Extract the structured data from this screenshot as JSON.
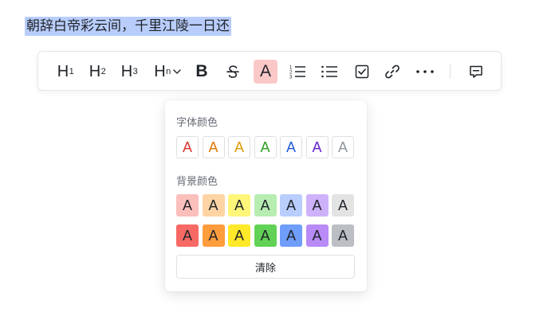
{
  "document": {
    "selected_text": "朝辞白帝彩云间，千里江陵一日还"
  },
  "toolbar": {
    "h1": {
      "main": "H",
      "sub": "1",
      "icon": "heading-1-icon"
    },
    "h2": {
      "main": "H",
      "sub": "2",
      "icon": "heading-2-icon"
    },
    "h3": {
      "main": "H",
      "sub": "3",
      "icon": "heading-3-icon"
    },
    "hn": {
      "main": "H",
      "sub": "n",
      "icon": "heading-more-icon"
    },
    "bold": "B",
    "strikethrough_icon": "strikethrough-icon",
    "font_color": "A",
    "active_highlight": "#fbc8c8",
    "ordered_list_icon": "ordered-list-icon",
    "bullet_list_icon": "bullet-list-icon",
    "checkbox_icon": "checkbox-icon",
    "link_icon": "link-icon",
    "more_icon": "more-icon",
    "comment_icon": "comment-icon"
  },
  "color_panel": {
    "font_color_title": "字体颜色",
    "background_color_title": "背景颜色",
    "swatch_letter": "A",
    "font_colors": [
      "#d83931",
      "#de7802",
      "#dc9b04",
      "#2ea121",
      "#245bdb",
      "#6425d0",
      "#8f959e"
    ],
    "bg_light_colors": [
      "#fbbfbc",
      "#fed4a4",
      "#fff67a",
      "#b7edb1",
      "#bacefd",
      "#cdb2fa",
      "#e3e3e4"
    ],
    "bg_dark_colors": [
      "#f76964",
      "#ff9d3d",
      "#ffe928",
      "#62d256",
      "#6f9dfb",
      "#b88bf7",
      "#bbbfc4"
    ],
    "clear_label": "清除"
  }
}
